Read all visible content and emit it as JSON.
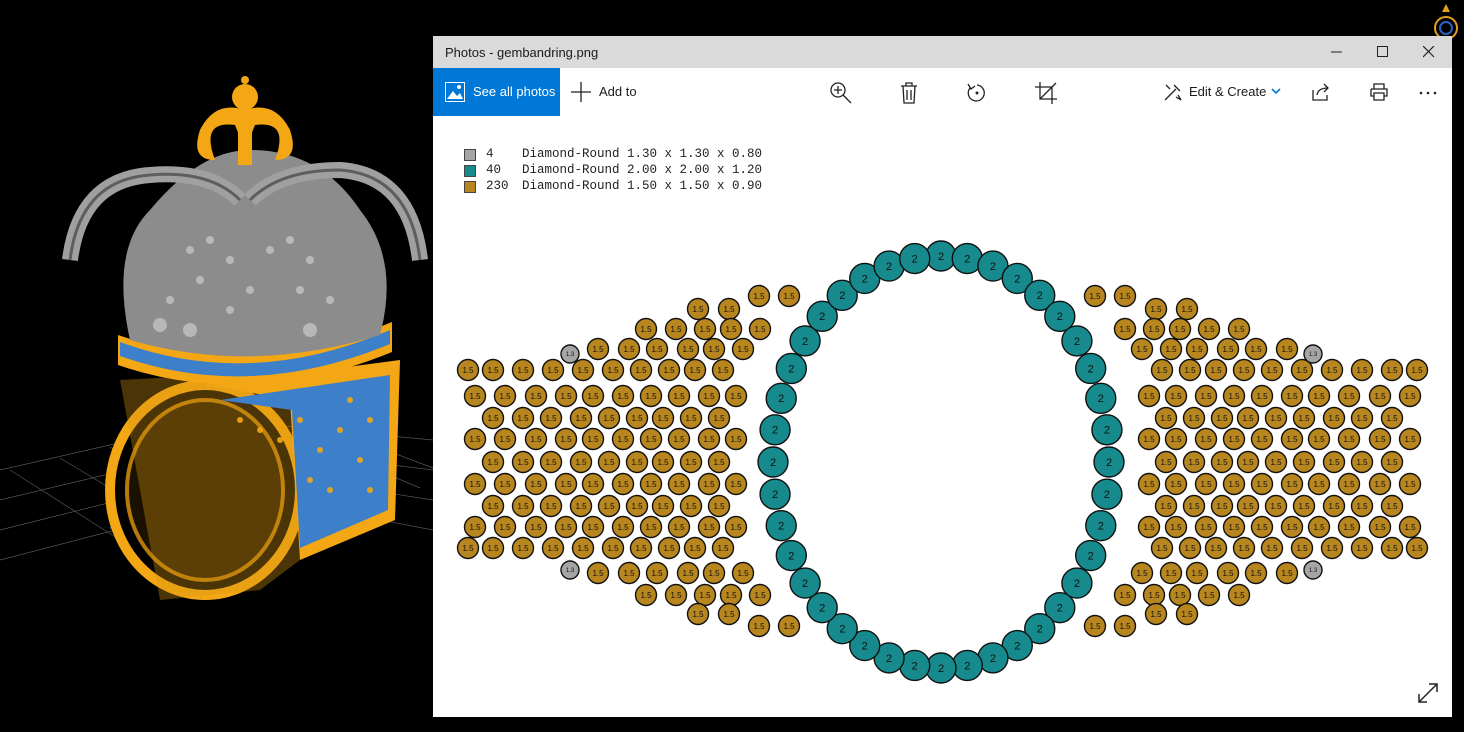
{
  "window": {
    "title": "Photos - gembandring.png"
  },
  "toolbar": {
    "see_all_label": "See all photos",
    "add_to_label": "Add to",
    "edit_create_label": "Edit & Create",
    "icons": [
      "zoom-in-icon",
      "delete-icon",
      "rotate-icon",
      "crop-icon",
      "share-icon",
      "print-icon",
      "more-icon"
    ]
  },
  "legend": [
    {
      "count": "4",
      "desc": "Diamond-Round 1.30 x 1.30 x 0.80",
      "color": "#a5a5a5"
    },
    {
      "count": "40",
      "desc": "Diamond-Round 2.00 x 2.00 x 1.20",
      "color": "#168a8c"
    },
    {
      "count": "230",
      "desc": "Diamond-Round 1.50 x 1.50 x 0.90",
      "color": "#b8861e"
    }
  ],
  "stone_labels": {
    "gray": "1.3",
    "teal": "2",
    "gold": "1.5"
  },
  "colors": {
    "accent": "#0078d7",
    "titlebar": "#dadada",
    "gold_metal": "#f0a818",
    "silver_metal": "#8c8c8c",
    "pave_blue": "#3d7fc8"
  }
}
